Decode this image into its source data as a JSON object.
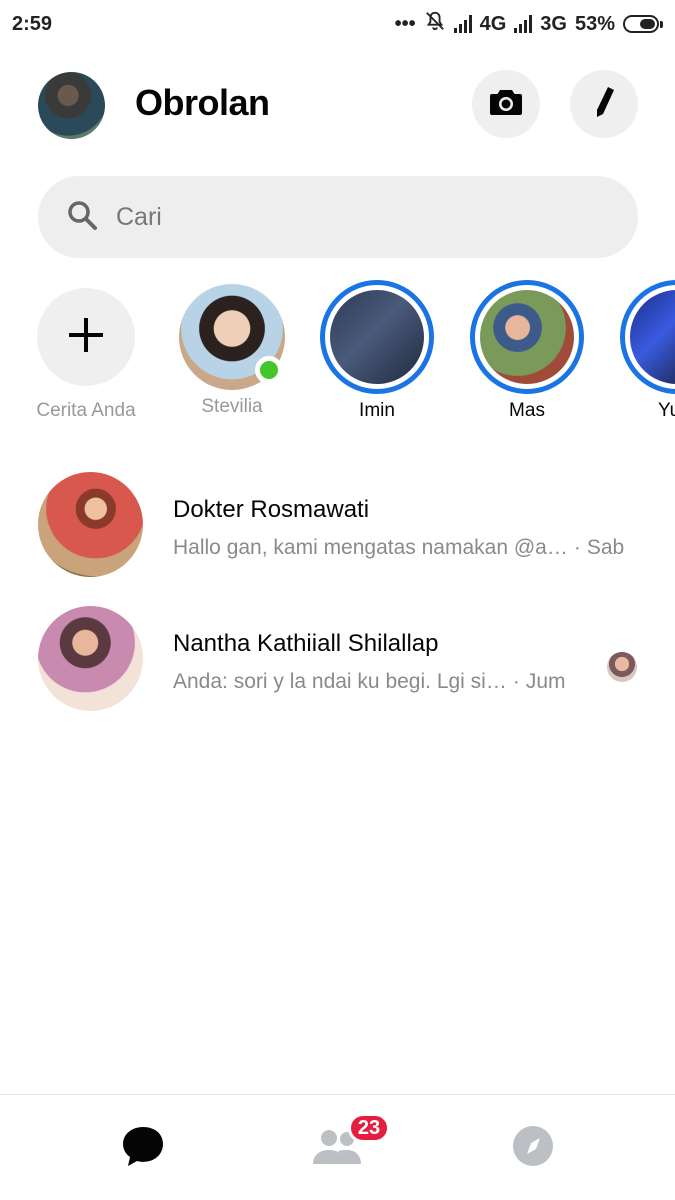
{
  "status_bar": {
    "time": "2:59",
    "network_1": "4G",
    "network_2": "3G",
    "battery": "53%",
    "icons": [
      "dots-icon",
      "mute-bell-icon",
      "signal-icon",
      "battery-icon"
    ]
  },
  "header": {
    "title": "Obrolan",
    "icons": [
      "camera-icon",
      "pencil-icon"
    ]
  },
  "search": {
    "placeholder": "Cari",
    "icon": "search-icon"
  },
  "stories": [
    {
      "label": "Cerita Anda",
      "type": "add",
      "icon": "plus-icon"
    },
    {
      "label": "Stevilia",
      "type": "contact",
      "online": true
    },
    {
      "label": "Imin",
      "type": "story",
      "ring": true
    },
    {
      "label": "Mas",
      "type": "story",
      "ring": true
    },
    {
      "label": "Yusr",
      "type": "story",
      "ring": true
    }
  ],
  "conversations": [
    {
      "name": "Dokter Rosmawati",
      "preview": "Hallo gan, kami mengatas namakan @a…",
      "time": "Sab"
    },
    {
      "name": "Nantha Kathiiall Shilallap",
      "preview": "Anda: sori y la ndai ku begi. Lgi si…",
      "time": "Jum",
      "seen_avatar": true
    }
  ],
  "bottom_nav": {
    "items": [
      "chat-bubble-icon",
      "people-icon",
      "compass-icon"
    ],
    "people_badge": "23"
  },
  "colors": {
    "accent": "#1b74e4",
    "online": "#42c62c",
    "badge": "#e41e3f",
    "chip_bg": "#efefef"
  }
}
